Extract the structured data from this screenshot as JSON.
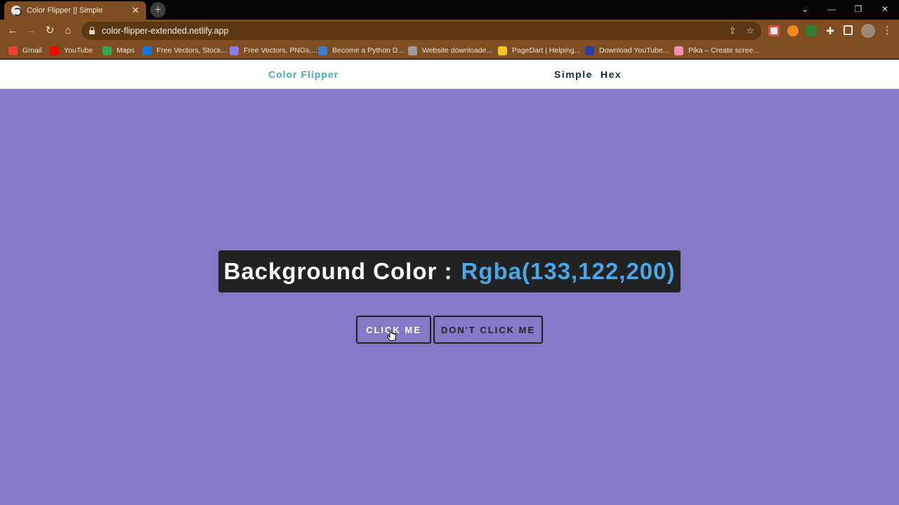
{
  "browser": {
    "tab_title": "Color Flipper || Simple",
    "new_tab_symbol": "+",
    "url": "color-flipper-extended.netlify.app",
    "bookmarks": [
      {
        "label": "Gmail",
        "icon": "gmail-icon",
        "color": "#ea4335"
      },
      {
        "label": "YouTube",
        "icon": "youtube-icon",
        "color": "#ff0000"
      },
      {
        "label": "Maps",
        "icon": "maps-icon",
        "color": "#34a853"
      },
      {
        "label": "Free Vectors, Stock...",
        "icon": "freepik-icon",
        "color": "#1273eb"
      },
      {
        "label": "Free Vectors, PNGs,...",
        "icon": "star-icon",
        "color": "#8a7bf0"
      },
      {
        "label": "Become a Python D...",
        "icon": "realpython-icon",
        "color": "#3a7bd5"
      },
      {
        "label": "Website downloade...",
        "icon": "globe-icon",
        "color": "#9e9e9e"
      },
      {
        "label": "PageDart | Helping...",
        "icon": "pagedart-icon",
        "color": "#f5c518"
      },
      {
        "label": "Download YouTube...",
        "icon": "download-icon",
        "color": "#2d3ea8"
      },
      {
        "label": "Pika – Create scree...",
        "icon": "pika-icon",
        "color": "#f48fb1"
      }
    ]
  },
  "navbar": {
    "brand": "Color Flipper",
    "links": [
      "Simple",
      "Hex"
    ]
  },
  "main": {
    "label": "Background Color :",
    "value": "Rgba(133,122,200)",
    "background": "#8578c7",
    "accent": "#49a6e9",
    "buttons": {
      "click": "CLICK ME",
      "dont": "DON'T CLICK ME"
    }
  }
}
